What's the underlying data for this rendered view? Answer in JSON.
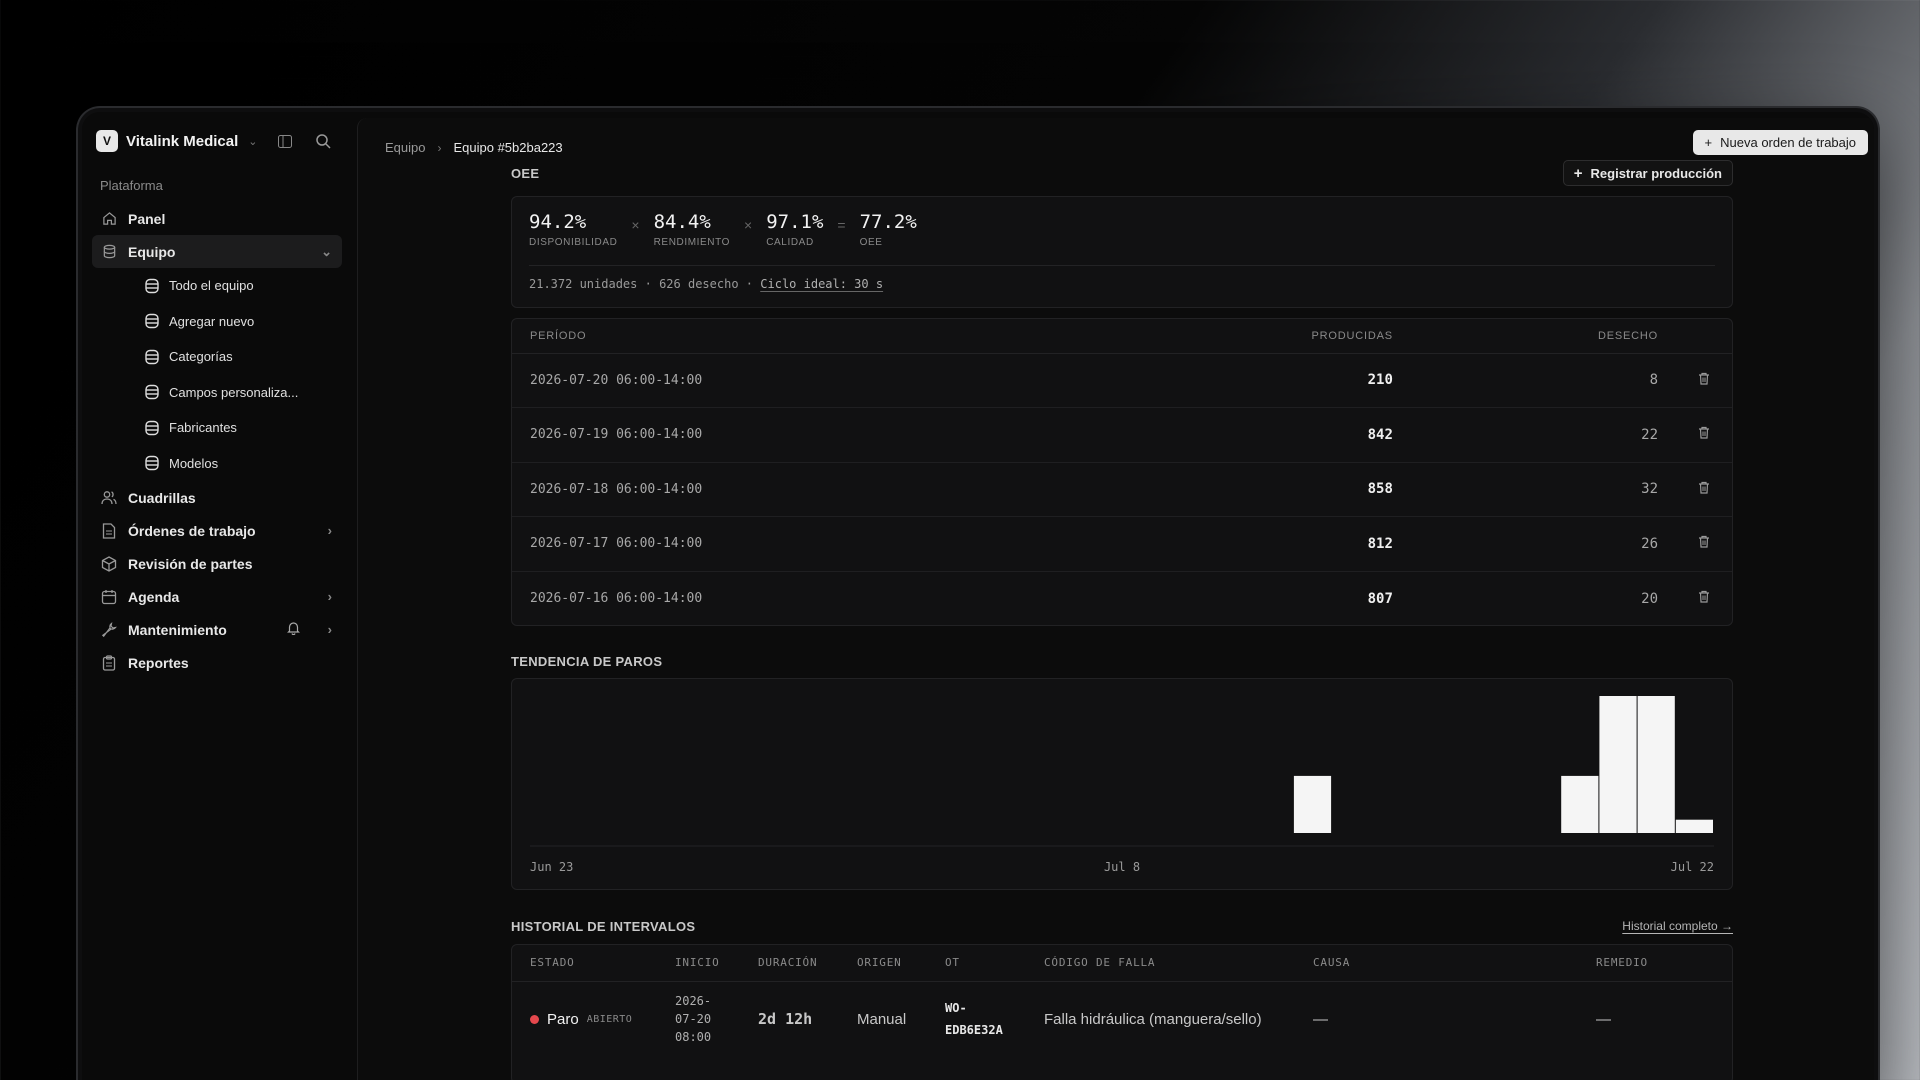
{
  "sidebar": {
    "brand_initial": "V",
    "brand_name": "Vitalink Medical",
    "section_label": "Plataforma",
    "items": [
      {
        "label": "Panel",
        "icon": "home-icon"
      },
      {
        "label": "Equipo",
        "icon": "database-icon"
      },
      {
        "label": "Cuadrillas",
        "icon": "users-icon"
      },
      {
        "label": "Órdenes de trabajo",
        "icon": "document-icon"
      },
      {
        "label": "Revisión de partes",
        "icon": "box-icon"
      },
      {
        "label": "Agenda",
        "icon": "calendar-icon"
      },
      {
        "label": "Mantenimiento",
        "icon": "wrench-icon"
      },
      {
        "label": "Reportes",
        "icon": "clipboard-icon"
      }
    ],
    "equipo_sub": [
      {
        "label": "Todo el equipo"
      },
      {
        "label": "Agregar nuevo"
      },
      {
        "label": "Categorías"
      },
      {
        "label": "Campos personaliza..."
      },
      {
        "label": "Fabricantes"
      },
      {
        "label": "Modelos"
      }
    ]
  },
  "header": {
    "breadcrumb_parent": "Equipo",
    "breadcrumb_current": "Equipo #5b2ba223",
    "new_work_order": "Nueva orden de trabajo"
  },
  "oee": {
    "title": "OEE",
    "register_button": "Registrar producción",
    "availability": "94.2%",
    "availability_label": "DISPONIBILIDAD",
    "performance": "84.4%",
    "performance_label": "RENDIMIENTO",
    "quality": "97.1%",
    "quality_label": "CALIDAD",
    "oee_value": "77.2%",
    "oee_label": "OEE",
    "op_times": "×",
    "op_equals": "=",
    "units": "21.372 unidades",
    "waste": "626 desecho",
    "separator": "·",
    "ideal_cycle": "Ciclo ideal: 30 s"
  },
  "production": {
    "headers": {
      "period": "PERÍODO",
      "produced": "PRODUCIDAS",
      "waste": "DESECHO"
    },
    "rows": [
      {
        "period": "2026-07-20 06:00-14:00",
        "produced": "210",
        "waste": "8"
      },
      {
        "period": "2026-07-19 06:00-14:00",
        "produced": "842",
        "waste": "22"
      },
      {
        "period": "2026-07-18 06:00-14:00",
        "produced": "858",
        "waste": "32"
      },
      {
        "period": "2026-07-17 06:00-14:00",
        "produced": "812",
        "waste": "26"
      },
      {
        "period": "2026-07-16 06:00-14:00",
        "produced": "807",
        "waste": "20"
      }
    ]
  },
  "trend": {
    "title": "TENDENCIA DE PAROS"
  },
  "chart_data": {
    "type": "bar",
    "title": "TENDENCIA DE PAROS",
    "x_tick_labels": [
      "Jun 23",
      "Jul 8",
      "Jul 22"
    ],
    "x": [
      "2026-06-23",
      "2026-06-24",
      "2026-06-25",
      "2026-06-26",
      "2026-06-27",
      "2026-06-28",
      "2026-06-29",
      "2026-06-30",
      "2026-07-01",
      "2026-07-02",
      "2026-07-03",
      "2026-07-04",
      "2026-07-05",
      "2026-07-06",
      "2026-07-07",
      "2026-07-08",
      "2026-07-09",
      "2026-07-10",
      "2026-07-11",
      "2026-07-12",
      "2026-07-13",
      "2026-07-14",
      "2026-07-15",
      "2026-07-16",
      "2026-07-17",
      "2026-07-18",
      "2026-07-19",
      "2026-07-20",
      "2026-07-21",
      "2026-07-22"
    ],
    "values": [
      0,
      0,
      0,
      0,
      0,
      0,
      0,
      0,
      0,
      0,
      0,
      0,
      0,
      0,
      0,
      0,
      0,
      0,
      0,
      0,
      1.5,
      0,
      0,
      0,
      0,
      0,
      0,
      1.5,
      3.6,
      3.6,
      0.35
    ],
    "ylim": [
      0,
      3.6
    ],
    "grid": false,
    "color": "#f5f5f5"
  },
  "history": {
    "title": "HISTORIAL DE INTERVALOS",
    "full_link": "Historial completo →",
    "headers": [
      "ESTADO",
      "INICIO",
      "DURACIÓN",
      "ORIGEN",
      "OT",
      "CÓDIGO DE FALLA",
      "CAUSA",
      "REMEDIO"
    ],
    "rows": [
      {
        "status": "Paro",
        "status_tag": "ABIERTO",
        "start_date_1": "2026-",
        "start_date_2": "07-20",
        "start_time": "08:00",
        "duration": "2d 12h",
        "origin": "Manual",
        "wo_1": "WO-",
        "wo_2": "EDB6E32A",
        "fault_code": "Falla hidráulica (manguera/sello)",
        "cause": "—",
        "remedy": "—"
      }
    ],
    "status_color": "#e5484d"
  }
}
